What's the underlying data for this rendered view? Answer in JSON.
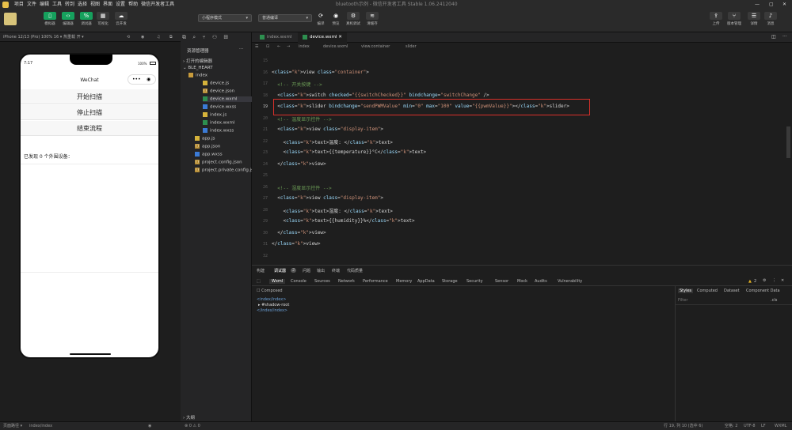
{
  "menu": [
    "项目",
    "文件",
    "编辑",
    "工具",
    "转到",
    "选择",
    "视图",
    "界面",
    "设置",
    "帮助",
    "微信开发者工具"
  ],
  "window_title": "bluetooth示例 - 微信开发者工具 Stable 1.06.2412040",
  "toolbar": {
    "simulator": "模拟器",
    "editor": "编辑器",
    "debugger": "调试器",
    "visual": "可视化",
    "cloud": "云开发",
    "mode": "小程序模式",
    "compile": "普通编译",
    "compile_btn": "编译",
    "preview": "预览",
    "realdebug": "真机调试",
    "clearcache": "清缓存",
    "upload": "上传",
    "version": "版本管理",
    "details": "详情",
    "message": "消息"
  },
  "simbar": {
    "device": "iPhone 12/13 (Pro) 100% 16 ▾",
    "hotreload": "热重载 开 ▾"
  },
  "phone": {
    "time": "7:17",
    "battery": "100%",
    "title": "WeChat",
    "btn_start": "开始扫描",
    "btn_stop": "停止扫描",
    "btn_end": "结束流程",
    "found": "已发现 0 个外围设备："
  },
  "explorer": {
    "title": "资源管理器",
    "open_editors": "打开的编辑器",
    "project": "BLE_HEART",
    "outline": "大纲",
    "files": [
      {
        "name": "index",
        "icon": "folder-icon"
      },
      {
        "name": "device.js",
        "icon": "js-icon"
      },
      {
        "name": "device.json",
        "icon": "json-icon"
      },
      {
        "name": "device.wxml",
        "icon": "wxml-icon"
      },
      {
        "name": "device.wxss",
        "icon": "wxss-icon"
      },
      {
        "name": "index.js",
        "icon": "js-icon"
      },
      {
        "name": "index.wxml",
        "icon": "wxml-icon"
      },
      {
        "name": "index.wxss",
        "icon": "wxss-icon"
      },
      {
        "name": "app.js",
        "icon": "js-icon"
      },
      {
        "name": "app.json",
        "icon": "json-icon"
      },
      {
        "name": "app.wxss",
        "icon": "wxss-icon"
      },
      {
        "name": "project.config.json",
        "icon": "json-icon"
      },
      {
        "name": "project.private.config.js...",
        "icon": "json-icon"
      }
    ]
  },
  "tabs": [
    {
      "label": "index.wxml"
    },
    {
      "label": "device.wxml"
    }
  ],
  "breadcrumb": [
    "index",
    "device.wxml",
    "view.container",
    "slider"
  ],
  "code": [
    {
      "n": "15",
      "c": ""
    },
    {
      "n": "16",
      "c": "<view class=\"container\">"
    },
    {
      "n": "17",
      "c": "  <!-- 开关按键 -->"
    },
    {
      "n": "18",
      "c": "  <switch checked=\"{{switchChecked}}\" bindchange=\"switchChange\" />"
    },
    {
      "n": "19",
      "c": "  <slider bindchange=\"sendPWMValue\" min=\"0\" max=\"100\" value=\"{{pwmValue}}\"></slider>"
    },
    {
      "n": "20",
      "c": "  <!-- 温度显示控件 -->"
    },
    {
      "n": "21",
      "c": "  <view class=\"display-item\">"
    },
    {
      "n": "22",
      "c": "    <text>温度: </text>"
    },
    {
      "n": "23",
      "c": "    <text>{{temperature}}°C</text>"
    },
    {
      "n": "24",
      "c": "  </view>"
    },
    {
      "n": "25",
      "c": ""
    },
    {
      "n": "26",
      "c": "  <!-- 湿度显示控件 -->"
    },
    {
      "n": "27",
      "c": "  <view class=\"display-item\">"
    },
    {
      "n": "28",
      "c": "    <text>湿度: </text>"
    },
    {
      "n": "29",
      "c": "    <text>{{humidity}}%</text>"
    },
    {
      "n": "30",
      "c": "  </view>"
    },
    {
      "n": "31",
      "c": "</view>"
    },
    {
      "n": "32",
      "c": ""
    },
    {
      "n": "33",
      "c": ""
    }
  ],
  "devtools": {
    "tabs_top": [
      "构建",
      "调试器",
      "问题",
      "输出",
      "终端",
      "代码质量"
    ],
    "badge": "2",
    "tabs": [
      "Wxml",
      "Console",
      "Sources",
      "Network",
      "Performance",
      "Memory",
      "AppData",
      "Storage",
      "Security",
      "Sensor",
      "Mock",
      "Audits",
      "Vulnerability"
    ],
    "warn": "2",
    "composed": "Composed",
    "tree": [
      "<index/index>",
      "▸ #shadow-root",
      "</index/index>"
    ],
    "side_tabs": [
      "Styles",
      "Computed",
      "Dataset",
      "Component Data"
    ],
    "filter": "Filter",
    "cls": ".cls"
  },
  "status": {
    "left": "页面路径 ▾",
    "path": "index/index",
    "errors": "⊗ 0 ⚠ 0",
    "pos": "行 19, 列 10 (选中 6)",
    "spaces": "空格: 2",
    "enc": "UTF-8",
    "eol": "LF",
    "lang": "WXML"
  }
}
